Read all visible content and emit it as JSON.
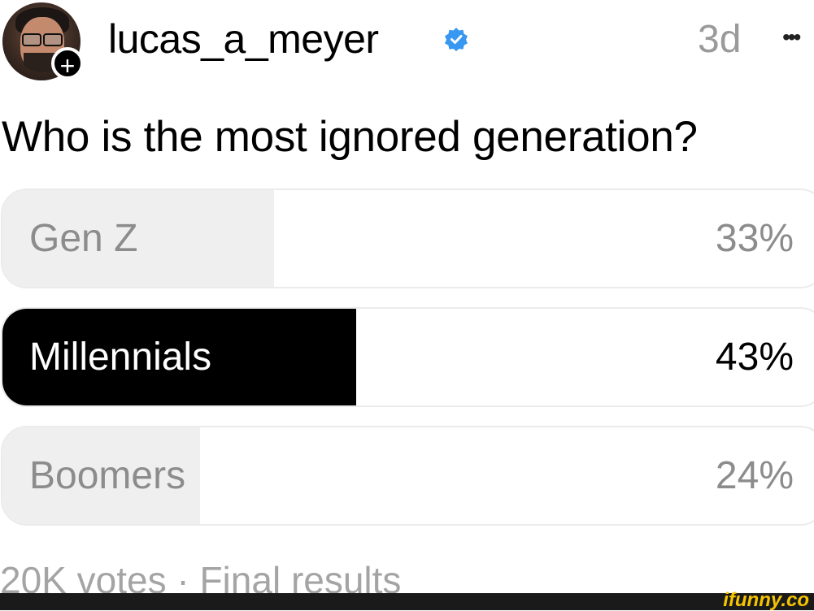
{
  "post": {
    "username": "lucas_a_meyer",
    "verified": true,
    "timestamp": "3d",
    "more_label": "•••",
    "follow_symbol": "+"
  },
  "poll": {
    "question": "Who is the most ignored generation?",
    "options": [
      {
        "label": "Gen Z",
        "percent_text": "33%",
        "percent": 33,
        "selected": false
      },
      {
        "label": "Millennials",
        "percent_text": "43%",
        "percent": 43,
        "selected": true
      },
      {
        "label": "Boomers",
        "percent_text": "24%",
        "percent": 24,
        "selected": false
      }
    ],
    "footer": "20K votes · Final results"
  },
  "watermark": "ifunny.co",
  "colors": {
    "verified_badge": "#3897f0",
    "selected_fill": "#000000",
    "unselected_fill": "#efefef",
    "muted_text": "#8c8c8c",
    "watermark": "#f5c400"
  },
  "icons": {
    "verified": "verified-badge-icon",
    "follow": "plus-icon",
    "more": "more-horizontal-icon"
  }
}
